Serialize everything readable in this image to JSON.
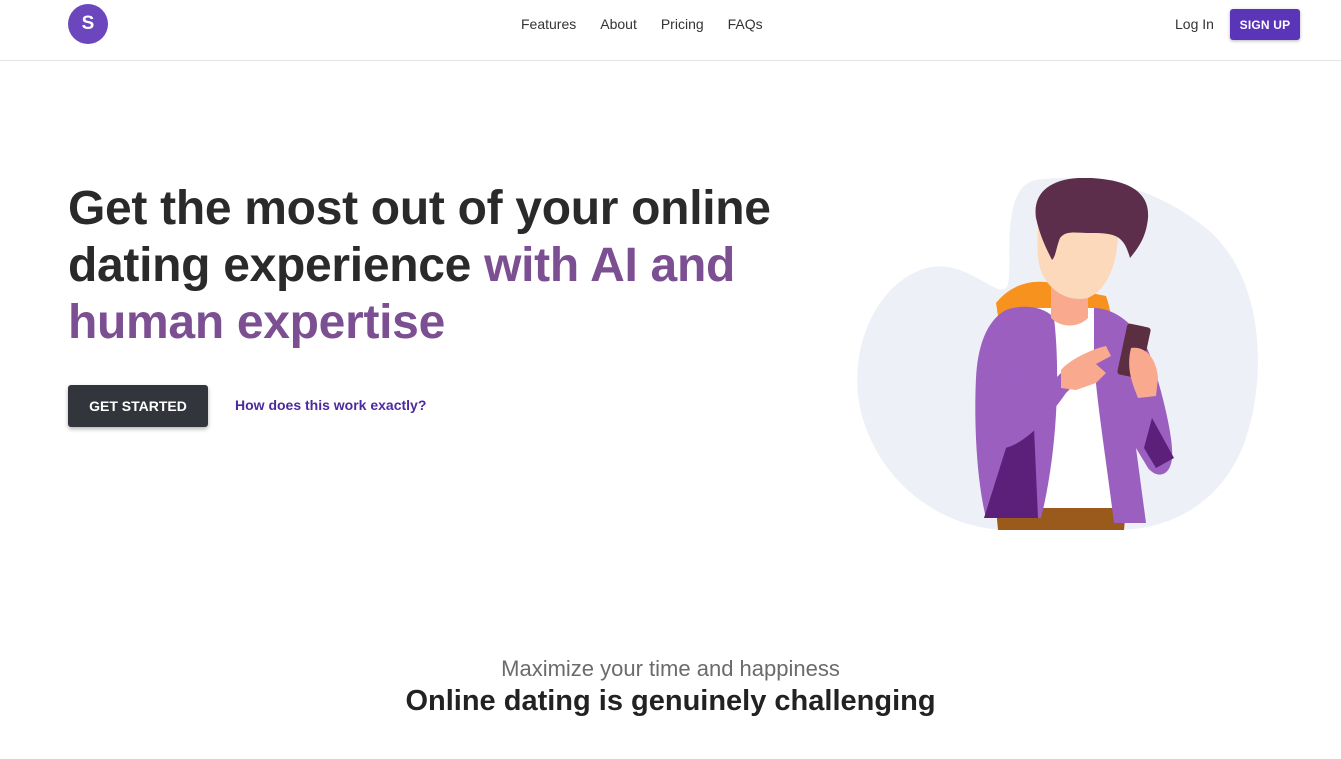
{
  "navbar": {
    "logo_letter": "S",
    "links": [
      "Features",
      "About",
      "Pricing",
      "FAQs"
    ],
    "login_label": "Log In",
    "signup_label": "SIGN UP"
  },
  "hero": {
    "title_plain": "Get the most out of your online dating experience ",
    "title_accent": "with AI and human expertise",
    "cta_label": "GET STARTED",
    "secondary_link": "How does this work exactly?"
  },
  "section": {
    "subtitle": "Maximize your time and happiness",
    "title": "Online dating is genuinely challenging"
  },
  "colors": {
    "brand_purple": "#6c46bd",
    "accent_text": "#7b4f92",
    "dark_button": "#32353c"
  }
}
